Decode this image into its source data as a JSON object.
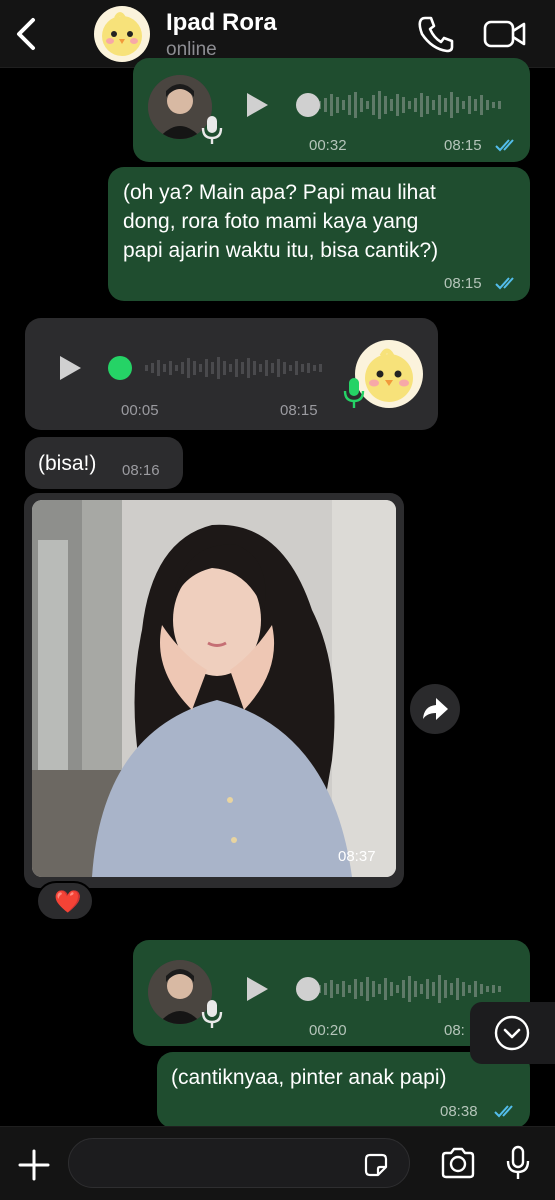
{
  "header": {
    "title": "Ipad Rora",
    "status": "online"
  },
  "messages": [
    {
      "kind": "voice",
      "direction": "out",
      "duration": "00:32",
      "time": "08:15"
    },
    {
      "kind": "text",
      "direction": "out",
      "lines": [
        "(oh ya? Main apa? Papi mau lihat",
        "dong, rora foto mami kaya yang",
        "papi ajarin waktu itu, bisa cantik?)"
      ],
      "time": "08:15"
    },
    {
      "kind": "voice",
      "direction": "in",
      "duration": "00:05",
      "time": "08:15"
    },
    {
      "kind": "text",
      "direction": "in",
      "text": "(bisa!)",
      "time": "08:16"
    },
    {
      "kind": "photo",
      "direction": "in",
      "time": "08:37",
      "reaction": "❤️"
    },
    {
      "kind": "voice",
      "direction": "out",
      "duration": "00:20",
      "time": "08:"
    },
    {
      "kind": "text",
      "direction": "out",
      "text": "(cantiknyaa, pinter anak papi)",
      "time": "08:38"
    }
  ],
  "colors": {
    "outgoing_bubble": "#1f4d2f",
    "incoming_bubble": "#2c2c2e",
    "read_ticks": "#53bdeb",
    "mic_green": "#25d366"
  },
  "icons": [
    "back-chevron-icon",
    "phone-icon",
    "video-call-icon",
    "play-icon",
    "mic-icon",
    "forward-icon",
    "scroll-down-icon",
    "plus-icon",
    "sticker-icon",
    "camera-icon"
  ]
}
